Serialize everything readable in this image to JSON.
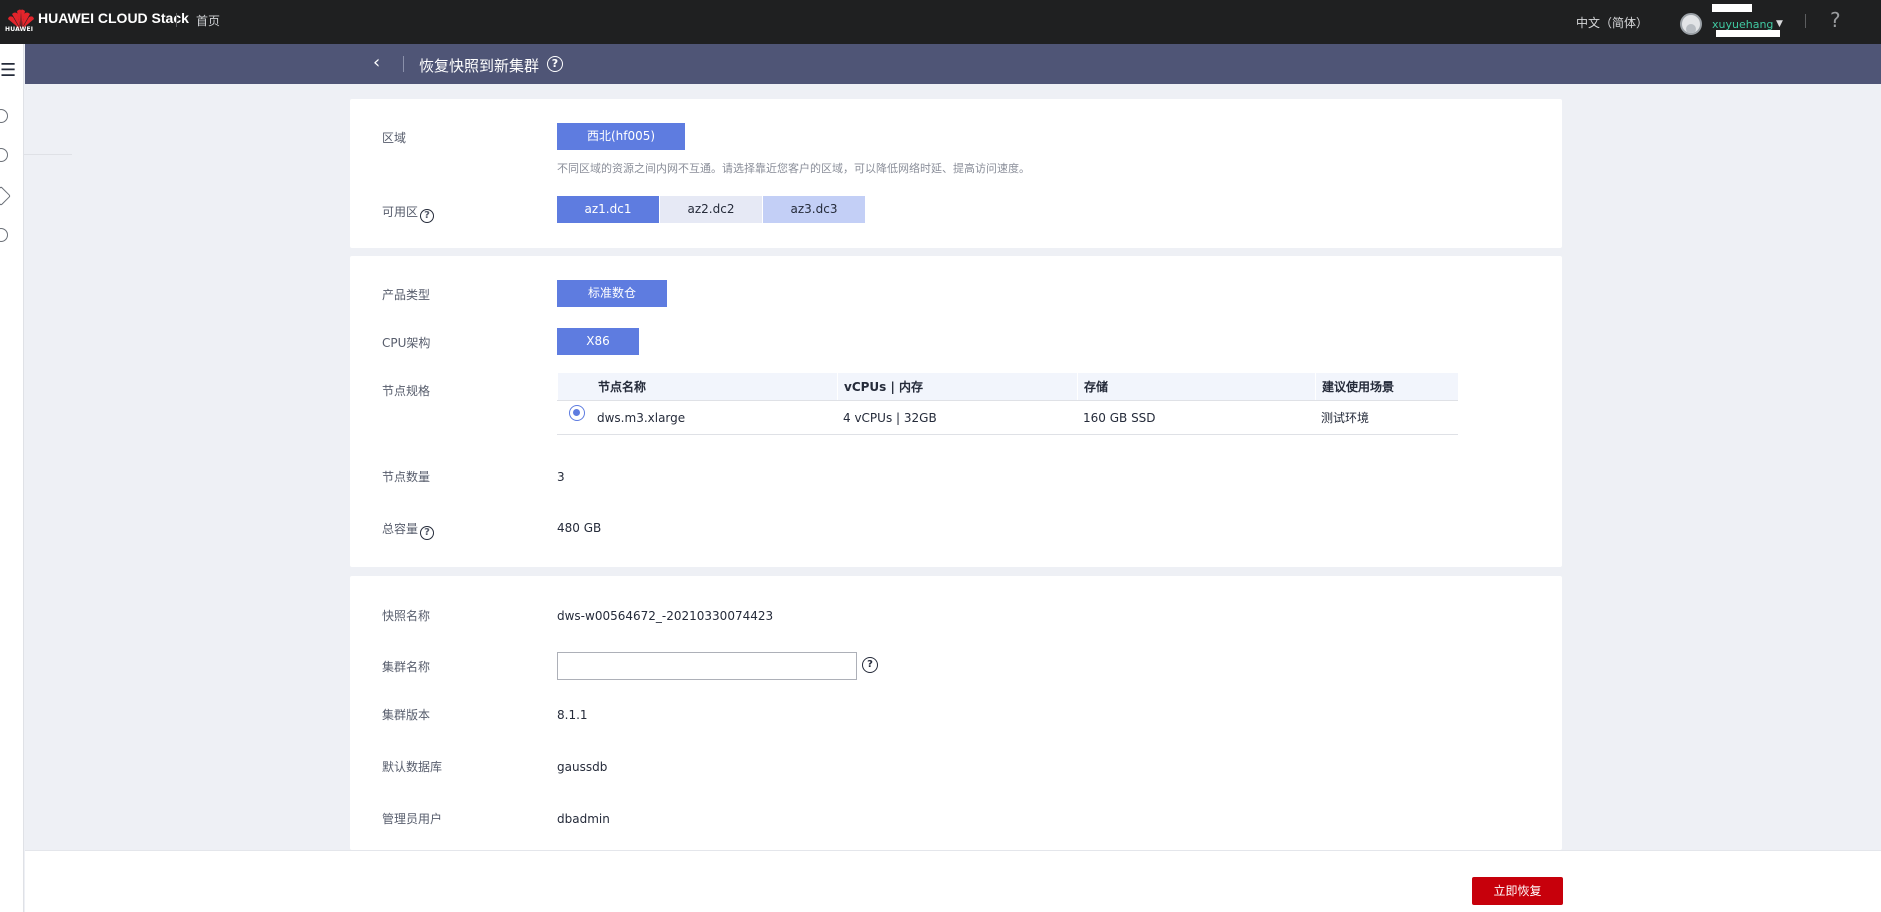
{
  "topbar": {
    "logo_text": "HUAWEI",
    "brand": "HUAWEI CLOUD Stack",
    "home": "首页",
    "language": "中文（简体）",
    "username": "xuyuehang",
    "caret": "▼",
    "help": "?"
  },
  "header": {
    "back": "‹",
    "title": "恢复快照到新集群",
    "help": "?"
  },
  "region": {
    "label": "区域",
    "selected": "西北(hf005)",
    "hint": "不同区域的资源之间内网不互通。请选择靠近您客户的区域，可以降低网络时延、提高访问速度。"
  },
  "az": {
    "label": "可用区",
    "help": "?",
    "options": [
      "az1.dc1",
      "az2.dc2",
      "az3.dc3"
    ]
  },
  "product": {
    "type_label": "产品类型",
    "type_value": "标准数仓",
    "cpu_label": "CPU架构",
    "cpu_value": "X86",
    "spec_label": "节点规格",
    "table": {
      "headers": [
        "节点名称",
        "vCPUs | 内存",
        "存储",
        "建议使用场景"
      ],
      "row": [
        "dws.m3.xlarge",
        "4 vCPUs | 32GB",
        "160 GB SSD",
        "测试环境"
      ]
    },
    "node_count_label": "节点数量",
    "node_count_value": "3",
    "capacity_label": "总容量",
    "capacity_help": "?",
    "capacity_value": "480 GB"
  },
  "snapshot": {
    "name_label": "快照名称",
    "name_value": "dws-w00564672_-20210330074423",
    "cluster_name_label": "集群名称",
    "cluster_name_value": "",
    "cluster_name_help": "?",
    "version_label": "集群版本",
    "version_value": "8.1.1",
    "db_label": "默认数据库",
    "db_value": "gaussdb",
    "admin_label": "管理员用户",
    "admin_value": "dbadmin"
  },
  "footer": {
    "restore_button": "立即恢复"
  },
  "colors": {
    "topbar": "#1f2021",
    "header": "#4f5576",
    "primary": "#5e7ce0",
    "danger": "#c7000b"
  }
}
